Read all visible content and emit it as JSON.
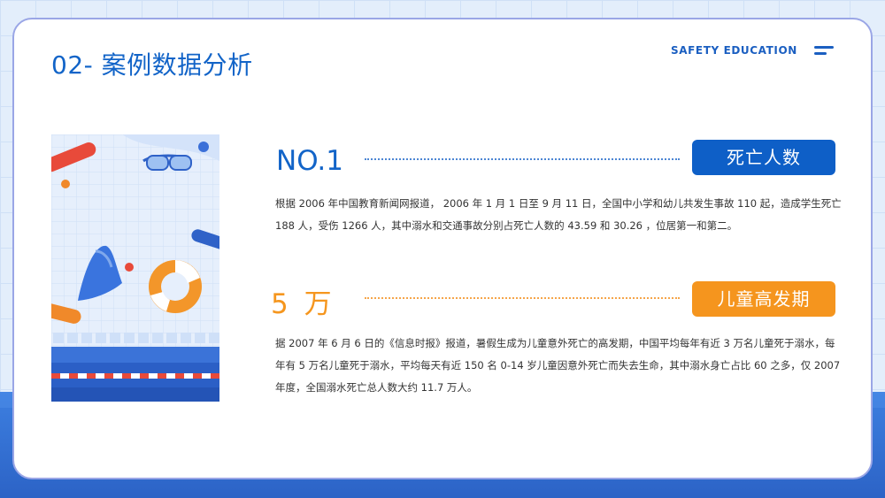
{
  "header": {
    "title": "02- 案例数据分析",
    "brand": "SAFETY  EDUCATION"
  },
  "items": [
    {
      "number": "NO.1",
      "tag": "死亡人数",
      "text": "根据 2006 年中国教育新闻网报道， 2006 年 1 月 1 日至 9 月 11 日，全国中小学和幼儿共发生事故 110 起，造成学生死亡 188 人，受伤 1266 人，其中溺水和交通事故分别占死亡人数的 43.59 和 30.26 ，位居第一和第二。"
    },
    {
      "number": "5 万",
      "tag": "儿童高发期",
      "text": "据 2007 年 6 月 6 日的《信息时报》报道，暑假生成为儿童意外死亡的高发期，中国平均每年有近 3 万名儿童死于溺水，每年有 5 万名儿童死于溺水，平均每天有近 150 名 0-14 岁儿童因意外死亡而失去生命，其中溺水身亡占比 60 之多，仅 2007 年度，全国溺水死亡总人数大约 11.7 万人。"
    }
  ],
  "colors": {
    "blue": "#0e5fc7",
    "orange": "#f5951e",
    "title_blue": "#1264c8"
  },
  "icons": [
    "menu-icon",
    "goggles-icon",
    "swim-fin-icon",
    "life-ring-icon",
    "pool-noodle-icon"
  ]
}
